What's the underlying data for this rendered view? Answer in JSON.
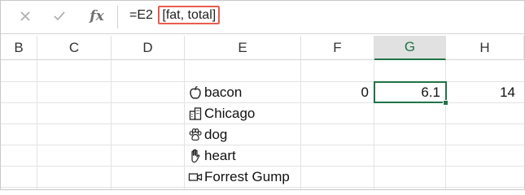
{
  "formula_bar": {
    "cancel_icon": "close-icon",
    "enter_icon": "checkmark-icon",
    "fx_label": "fx",
    "formula_prefix": "=E2",
    "formula_highlight": "[fat, total]"
  },
  "columns": [
    "B",
    "C",
    "D",
    "E",
    "F",
    "G",
    "H"
  ],
  "selected_column": "G",
  "rows": [
    {
      "e_icon": "apple-icon",
      "e_text": "bacon",
      "f": "0",
      "g": "6.1",
      "h": "14"
    },
    {
      "e_icon": "city-icon",
      "e_text": "Chicago",
      "f": "",
      "g": "",
      "h": ""
    },
    {
      "e_icon": "paw-icon",
      "e_text": "dog",
      "f": "",
      "g": "",
      "h": ""
    },
    {
      "e_icon": "hand-icon",
      "e_text": "heart",
      "f": "",
      "g": "",
      "h": ""
    },
    {
      "e_icon": "video-camera-icon",
      "e_text": "Forrest Gump",
      "f": "",
      "g": "",
      "h": ""
    }
  ],
  "colors": {
    "accent": "#217346",
    "highlight_border": "#e85c4f"
  }
}
